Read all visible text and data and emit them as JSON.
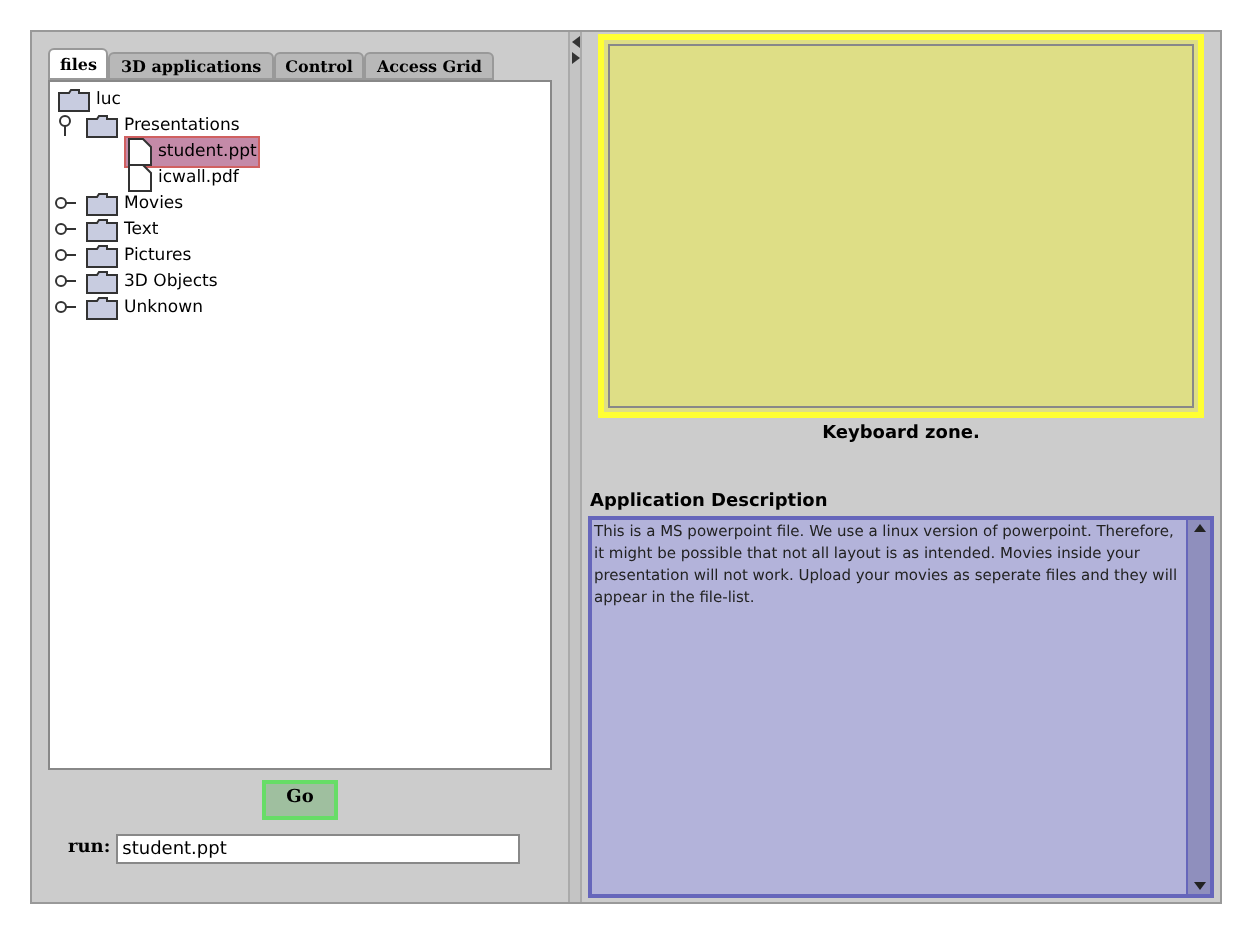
{
  "tabs": [
    {
      "label": "files",
      "selected": true
    },
    {
      "label": "3D applications",
      "selected": false
    },
    {
      "label": "Control",
      "selected": false
    },
    {
      "label": "Access Grid",
      "selected": false
    }
  ],
  "tree": [
    {
      "kind": "folder",
      "label": "luc",
      "selected": false,
      "children": [
        {
          "kind": "folder",
          "label": "Presentations",
          "expanded": true,
          "selected": false,
          "children": [
            {
              "kind": "file",
              "label": "student.ppt",
              "selected": true
            },
            {
              "kind": "file",
              "label": "icwall.pdf",
              "selected": false
            }
          ]
        },
        {
          "kind": "folder",
          "label": "Movies",
          "expanded": false,
          "selected": false
        },
        {
          "kind": "folder",
          "label": "Text",
          "expanded": false,
          "selected": false
        },
        {
          "kind": "folder",
          "label": "Pictures",
          "expanded": false,
          "selected": false
        },
        {
          "kind": "folder",
          "label": "3D Objects",
          "expanded": false,
          "selected": false
        },
        {
          "kind": "folder",
          "label": "Unknown",
          "expanded": false,
          "selected": false
        }
      ]
    }
  ],
  "go_button": "Go",
  "run": {
    "label": "run:",
    "value": "student.ppt"
  },
  "keyboard_zone": {
    "caption": "Keyboard zone."
  },
  "description": {
    "title": "Application Description",
    "text": "This is a MS powerpoint file. We use a linux version of powerpoint. Therefore, it might be possible that not all layout is as intended. Movies inside your presentation will not work. Upload your movies as seperate files and they will appear in the file-list."
  }
}
